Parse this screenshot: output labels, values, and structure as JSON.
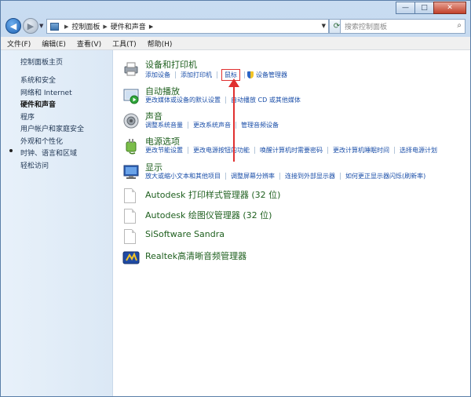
{
  "window": {
    "controls": {
      "minimize": "—",
      "maximize": "□",
      "close": "✕"
    }
  },
  "address": {
    "crumbs": [
      "控制面板",
      "硬件和声音"
    ],
    "search_placeholder": "搜索控制面板"
  },
  "menu": [
    "文件(F)",
    "编辑(E)",
    "查看(V)",
    "工具(T)",
    "帮助(H)"
  ],
  "sidebar": {
    "items": [
      "控制面板主页",
      "系统和安全",
      "网络和 Internet",
      "硬件和声音",
      "程序",
      "用户帐户和家庭安全",
      "外观和个性化",
      "时钟、语言和区域",
      "轻松访问"
    ],
    "current_index": 3
  },
  "categories": [
    {
      "title": "设备和打印机",
      "icon": "printer-icon",
      "links": [
        "添加设备",
        "添加打印机",
        "鼠标",
        "设备管理器"
      ],
      "highlighted": "鼠标"
    },
    {
      "title": "自动播放",
      "icon": "autoplay-icon",
      "links": [
        "更改媒体或设备的默认设置",
        "自动播放 CD 或其他媒体"
      ]
    },
    {
      "title": "声音",
      "icon": "speaker-icon",
      "links": [
        "调整系统音量",
        "更改系统声音",
        "管理音频设备"
      ]
    },
    {
      "title": "电源选项",
      "icon": "power-icon",
      "links": [
        "更改节能设置",
        "更改电源按钮的功能",
        "唤醒计算机时需要密码",
        "更改计算机睡眠时间",
        "选择电源计划"
      ]
    },
    {
      "title": "显示",
      "icon": "display-icon",
      "links": [
        "放大或缩小文本和其他项目",
        "调整屏幕分辨率",
        "连接到外部显示器",
        "如何更正显示器闪烁(刷新率)"
      ]
    }
  ],
  "programs": [
    {
      "title": "Autodesk 打印样式管理器 (32 位)",
      "icon": "document-icon"
    },
    {
      "title": "Autodesk 绘图仪管理器 (32 位)",
      "icon": "document-icon"
    },
    {
      "title": "SiSoftware Sandra",
      "icon": "document-icon"
    },
    {
      "title": "Realtek高清晰音频管理器",
      "icon": "realtek-icon"
    }
  ],
  "annotation_color": "#e03030",
  "link_color": "#1a4ea8",
  "title_color": "#1e5f1e"
}
